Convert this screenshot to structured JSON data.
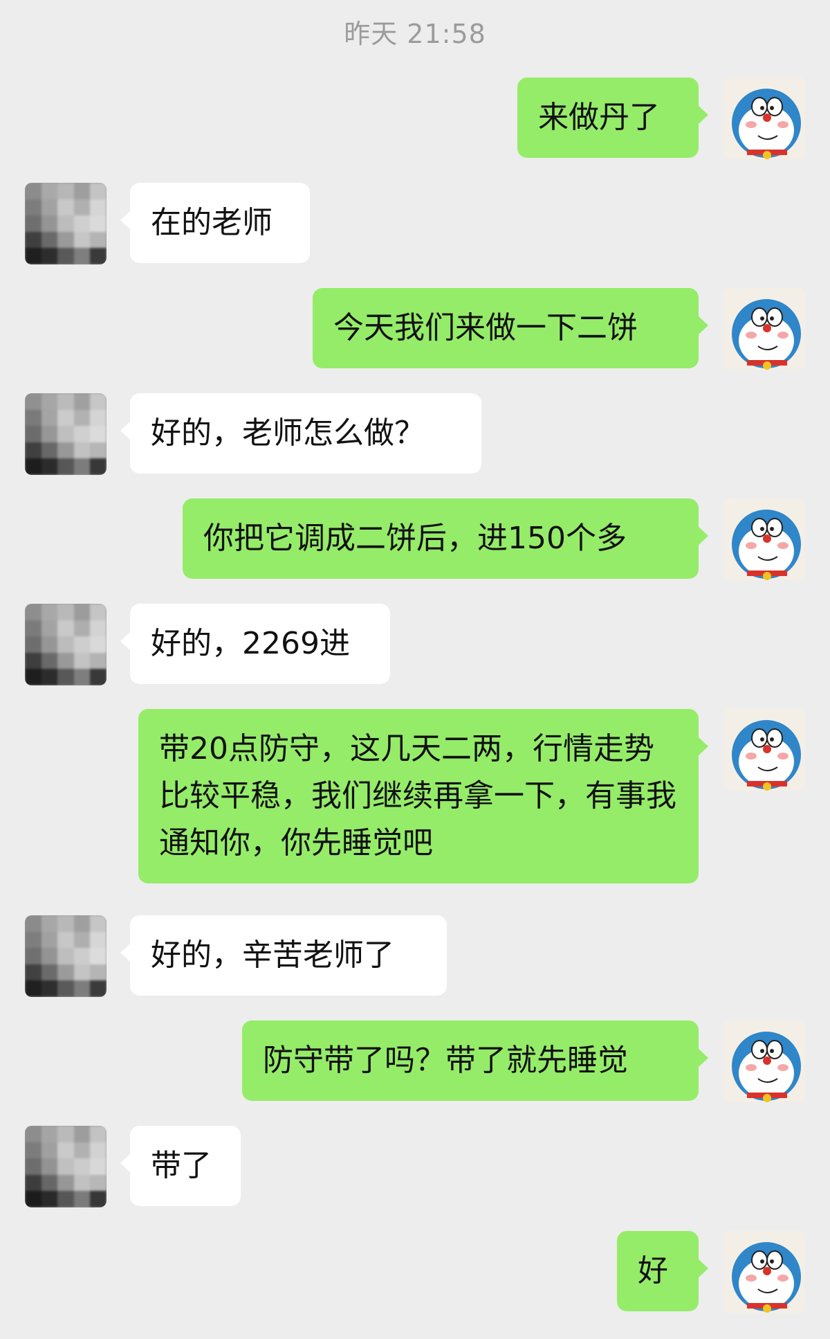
{
  "timestamp": "昨天 21:58",
  "messages": [
    {
      "sender": "self",
      "text": "来做丹了"
    },
    {
      "sender": "other",
      "text": "在的老师"
    },
    {
      "sender": "self",
      "text": "今天我们来做一下二饼"
    },
    {
      "sender": "other",
      "text": "好的，老师怎么做？"
    },
    {
      "sender": "self",
      "text": "你把它调成二饼后，进150个多"
    },
    {
      "sender": "other",
      "text": "好的，2269进"
    },
    {
      "sender": "self",
      "text": "带20点防守，这几天二两，行情走势比较平稳，我们继续再拿一下，有事我通知你，你先睡觉吧"
    },
    {
      "sender": "other",
      "text": "好的，辛苦老师了"
    },
    {
      "sender": "self",
      "text": "防守带了吗？带了就先睡觉"
    },
    {
      "sender": "other",
      "text": "带了"
    },
    {
      "sender": "self",
      "text": "好"
    }
  ],
  "avatars": {
    "self": "doraemon-avatar-icon",
    "other": "pixelated-avatar-icon"
  },
  "colors": {
    "background": "#ededed",
    "self_bubble": "#95ec69",
    "other_bubble": "#ffffff",
    "timestamp_text": "#9b9b9b"
  }
}
